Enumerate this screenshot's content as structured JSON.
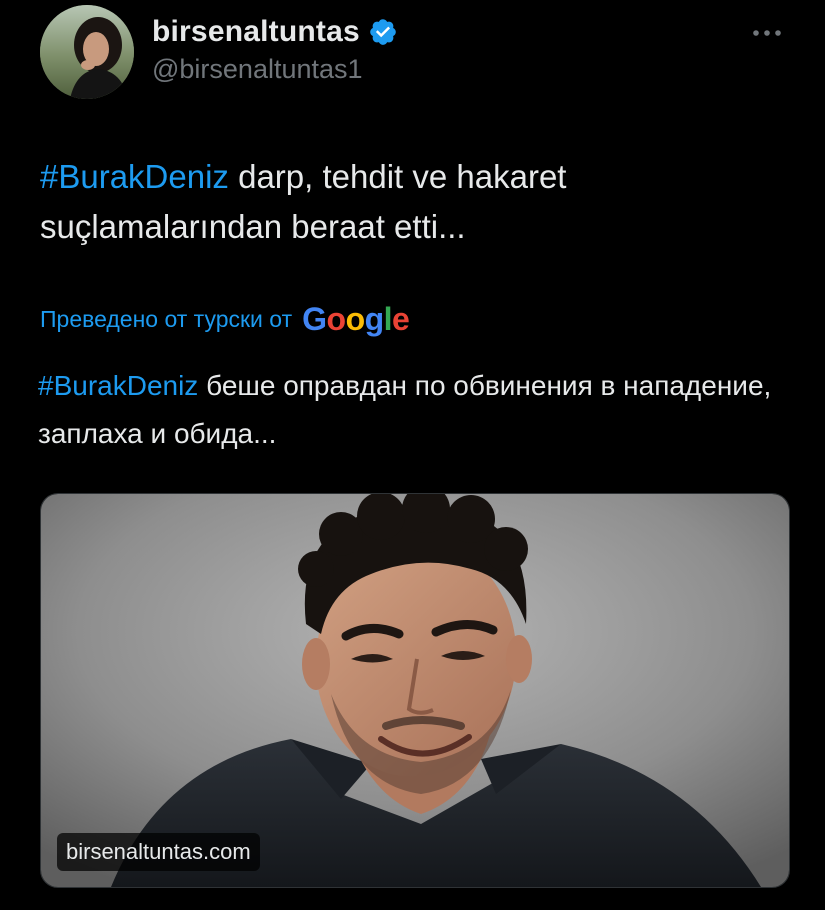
{
  "author": {
    "display_name": "birsenaltuntas",
    "handle": "@birsenaltuntas1",
    "verified": true,
    "avatar_icon": "profile-photo"
  },
  "more_icon": "ellipsis-icon",
  "tweet": {
    "hashtag": "#BurakDeniz",
    "text_rest": " darp, tehdit ve hakaret suçlamalarından beraat etti..."
  },
  "translation": {
    "label": "Преведено от турски от",
    "provider": "Google",
    "hashtag": "#BurakDeniz",
    "text_rest": " беше оправдан по обвинения в нападение, заплаха и обида..."
  },
  "media": {
    "source_label": "birsenaltuntas.com"
  },
  "colors": {
    "background": "#000000",
    "text": "#e7e9ea",
    "muted": "#71767b",
    "accent": "#1d9bf0",
    "google_blue": "#4285f4",
    "google_red": "#ea4335",
    "google_yellow": "#fbbc05",
    "google_green": "#34a853"
  }
}
